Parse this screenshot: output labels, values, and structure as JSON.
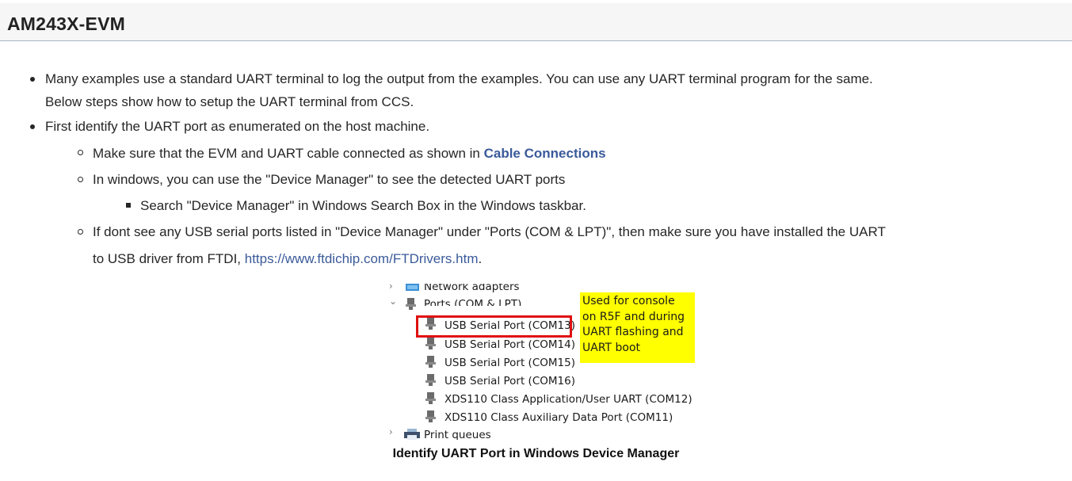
{
  "section": {
    "title": "AM243X-EVM"
  },
  "bullets": {
    "b1_line1": "Many examples use a standard UART terminal to log the output from the examples. You can use any UART terminal program for the same.",
    "b1_line2": "Below steps show how to setup the UART terminal from CCS.",
    "b2": "First identify the UART port as enumerated on the host machine.",
    "s1_text": "Make sure that the EVM and UART cable connected as shown in ",
    "s1_link": "Cable Connections",
    "s2": "In windows, you can use the \"Device Manager\" to see the detected UART ports",
    "ss1": "Search \"Device Manager\" in Windows Search Box in the Windows taskbar.",
    "s3_line1": "If dont see any USB serial ports listed in \"Device Manager\" under \"Ports (COM & LPT)\", then make sure you have installed the UART",
    "s3_line2_text": "to USB driver from FTDI, ",
    "s3_link": "https://www.ftdichip.com/FTDrivers.htm",
    "s3_end": "."
  },
  "device_manager": {
    "network_adapters": "Network adapters",
    "ports_group": "Ports (COM & LPT)",
    "ports": [
      "USB Serial Port (COM13)",
      "USB Serial Port (COM14)",
      "USB Serial Port (COM15)",
      "USB Serial Port (COM16)",
      "XDS110 Class Application/User UART (COM12)",
      "XDS110 Class Auxiliary Data Port (COM11)"
    ],
    "print_queues": "Print queues",
    "note_lines": [
      "Used for console",
      "on R5F and during",
      "UART flashing and",
      "UART boot"
    ],
    "note_color": "#ffff00",
    "highlight_color": "#e01010"
  },
  "figure": {
    "caption": "Identify UART Port in Windows Device Manager"
  },
  "colors": {
    "link": "#3a5a9a",
    "header_bg": "#f6f6f6"
  }
}
